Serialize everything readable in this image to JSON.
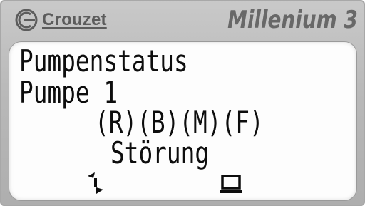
{
  "device": {
    "brand": "Crouzet",
    "model": "Millenium 3"
  },
  "display": {
    "lines": [
      "Pumpenstatus",
      "Pumpe 1",
      "(R)(B)(M)(F)",
      "Störung"
    ],
    "icons": [
      "navigation-arrows-icon",
      "screen-icon"
    ]
  }
}
